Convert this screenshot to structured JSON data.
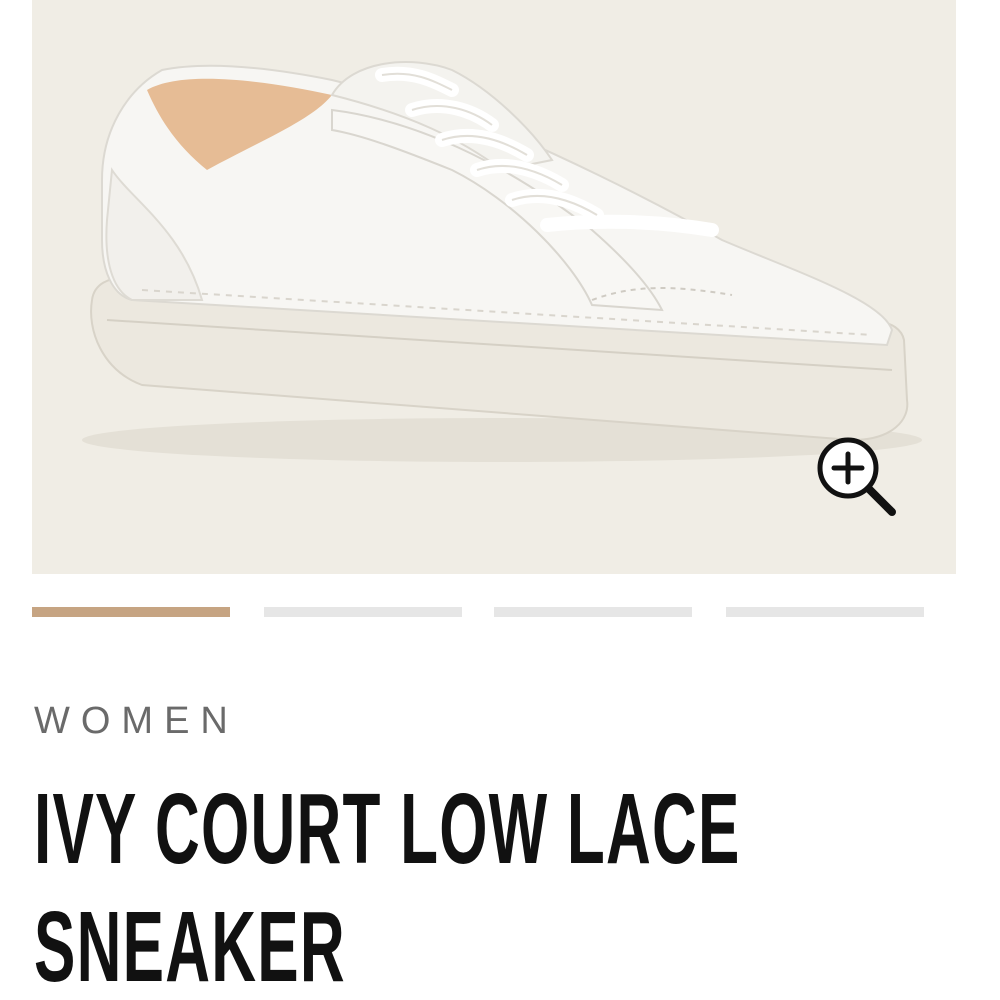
{
  "product": {
    "category": "WOMEN",
    "title": "IVY COURT LOW LACE SNEAKER",
    "image_description_icon": "sneaker-image"
  },
  "gallery": {
    "slide_count": 4,
    "active_slide": 1,
    "zoom_icon": "zoom-in-icon"
  },
  "colors": {
    "image_background": "#f0ede5",
    "active_indicator": "#c6a482",
    "inactive_indicator": "#e6e6e6",
    "title_text": "#111111",
    "category_text": "#6a6a6a"
  }
}
